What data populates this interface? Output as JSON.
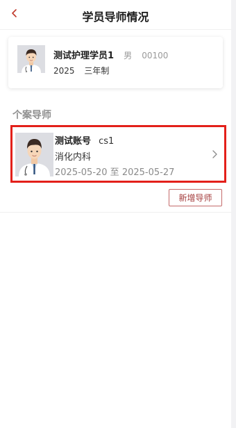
{
  "header": {
    "title": "学员导师情况",
    "back_icon": "chevron-left-icon"
  },
  "student": {
    "name": "测试护理学员1",
    "gender": "男",
    "id": "00100",
    "year": "2025",
    "program": "三年制"
  },
  "mentor_section": {
    "title": "个案导师",
    "mentors": [
      {
        "name": "测试账号",
        "account": "cs1",
        "department": "消化内科",
        "date_range": "2025-05-20 至 2025-05-27"
      }
    ]
  },
  "actions": {
    "add_mentor_label": "新增导师"
  },
  "colors": {
    "back_icon": "#c0392b",
    "highlight_border": "#e3201a",
    "button_border": "#c46a6a",
    "button_text": "#a33a3a"
  }
}
